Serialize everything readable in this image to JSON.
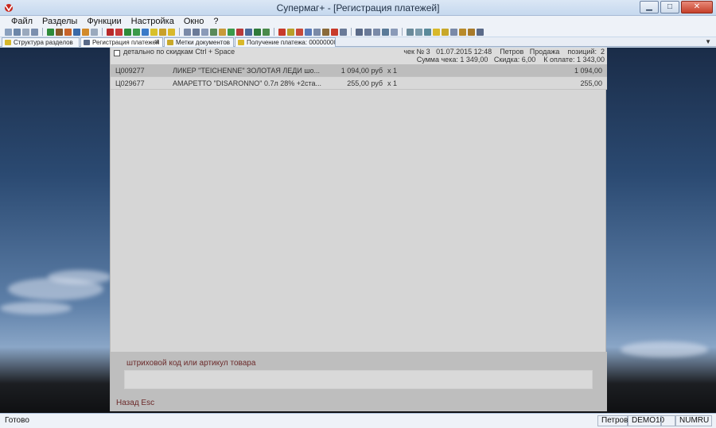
{
  "window": {
    "title": "Супермаг+  - [Регистрация платежей]",
    "minimize_icon": "minimize-icon",
    "maximize_icon": "maximize-icon",
    "close_icon": "close-icon",
    "min_glyph": "▁",
    "max_glyph": "□",
    "close_glyph": "✕"
  },
  "menu": [
    "Файл",
    "Разделы",
    "Функции",
    "Настройка",
    "Окно",
    "?"
  ],
  "tabs": [
    {
      "label": "Структура разделов",
      "active": false
    },
    {
      "label": "Регистрация платежей",
      "active": true,
      "closable": true
    },
    {
      "label": "Метки документов",
      "active": false
    },
    {
      "label": "Получение платежа: 0000000005",
      "active": false
    }
  ],
  "tab_close_glyph": "✕",
  "tab_dropdown_glyph": "▼",
  "receipt": {
    "detail_checkbox_label": "детально по скидкам Ctrl + Space",
    "line1": "чек № 3   01.07.2015 12:48    Петров   Продажа    позиций:  2",
    "line2": "Сумма чека: 1 349,00   Скидка: 6,00    К оплате: 1 343,00"
  },
  "items": [
    {
      "code": "Ц009277",
      "name": "ЛИКЕР \"TEICHENNE\" ЗОЛОТАЯ ЛЕДИ шо...",
      "price": "1 094,00 руб",
      "qty": "x 1",
      "sum": "1 094,00",
      "selected": true
    },
    {
      "code": "Ц029677",
      "name": "АМАРЕТТО \"DISARONNO\"  0.7л 28% +2ста...",
      "price": "255,00 руб",
      "qty": "x 1",
      "sum": "255,00",
      "selected": false
    }
  ],
  "barcode": {
    "label": "штриховой код или артикул товара",
    "value": "",
    "placeholder": ""
  },
  "back_label": "Назад Esc",
  "status": {
    "text": "Готово",
    "user": "Петров",
    "db": "DEMO10",
    "numlock": "NUMRU"
  },
  "colors": {
    "accent_text": "#6b2a2a",
    "selected_row": "#bdbdbd"
  }
}
